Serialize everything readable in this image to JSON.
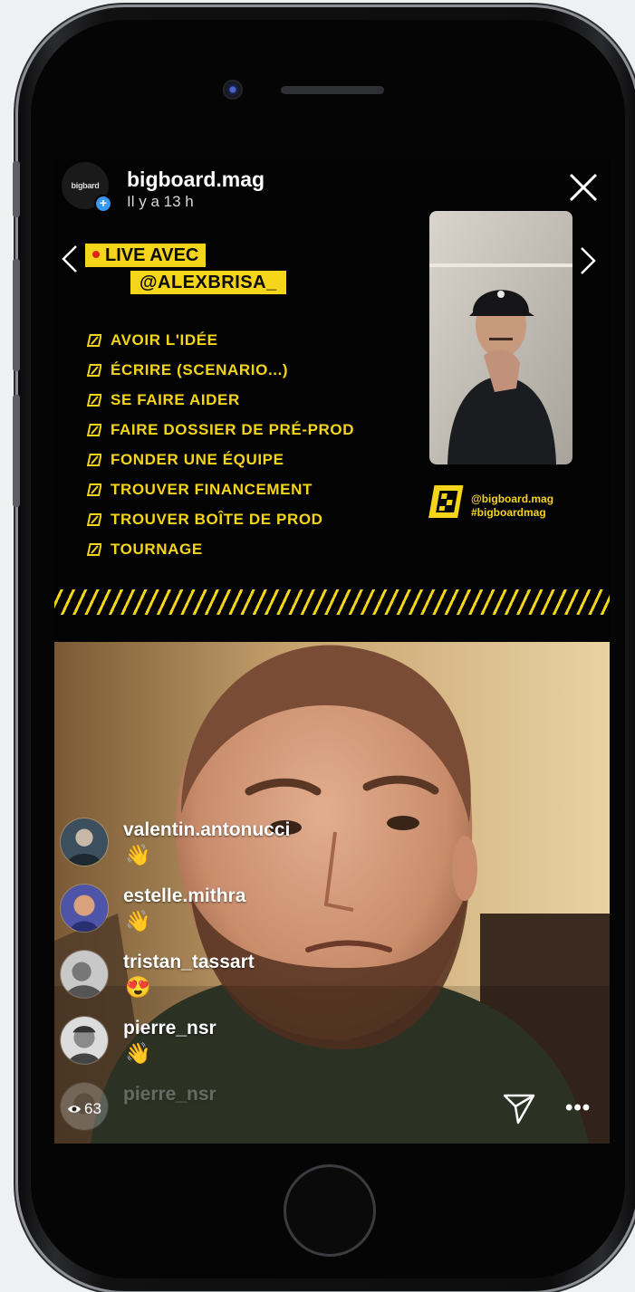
{
  "story": {
    "username": "bigboard.mag",
    "time": "Il y a 13 h",
    "avatar_text": "bigb​ard"
  },
  "live": {
    "line1": "LIVE AVEC",
    "line2": "@ALEXBRISA_"
  },
  "checklist": [
    "AVOIR L'IDÉE",
    "ÉCRIRE  (SCENARIO...)",
    "SE FAIRE AIDER",
    "FAIRE DOSSIER DE PRÉ-PROD",
    "FONDER UNE ÉQUIPE",
    "TROUVER FINANCEMENT",
    "TROUVER BOÎTE DE PROD",
    "TOURNAGE"
  ],
  "brand": {
    "handle": "@bigboard.mag",
    "hashtag": "#bigboardmag"
  },
  "comments": [
    {
      "user": "valentin.antonucci",
      "emoji": "👋"
    },
    {
      "user": "estelle.mithra",
      "emoji": "👋"
    },
    {
      "user": "tristan_tassart",
      "emoji": "😍"
    },
    {
      "user": "pierre_nsr",
      "emoji": "👋"
    },
    {
      "user": "pierre_nsr",
      "emoji": ""
    }
  ],
  "viewers": "63",
  "icons": {
    "close": "close-icon",
    "prev": "chevron-left-icon",
    "next": "chevron-right-icon",
    "send": "send-icon",
    "more": "more-icon",
    "eye": "eye-icon"
  },
  "colors": {
    "accent_yellow": "#f5d519",
    "live_red": "#e2231a",
    "plus_blue": "#3897f0"
  }
}
